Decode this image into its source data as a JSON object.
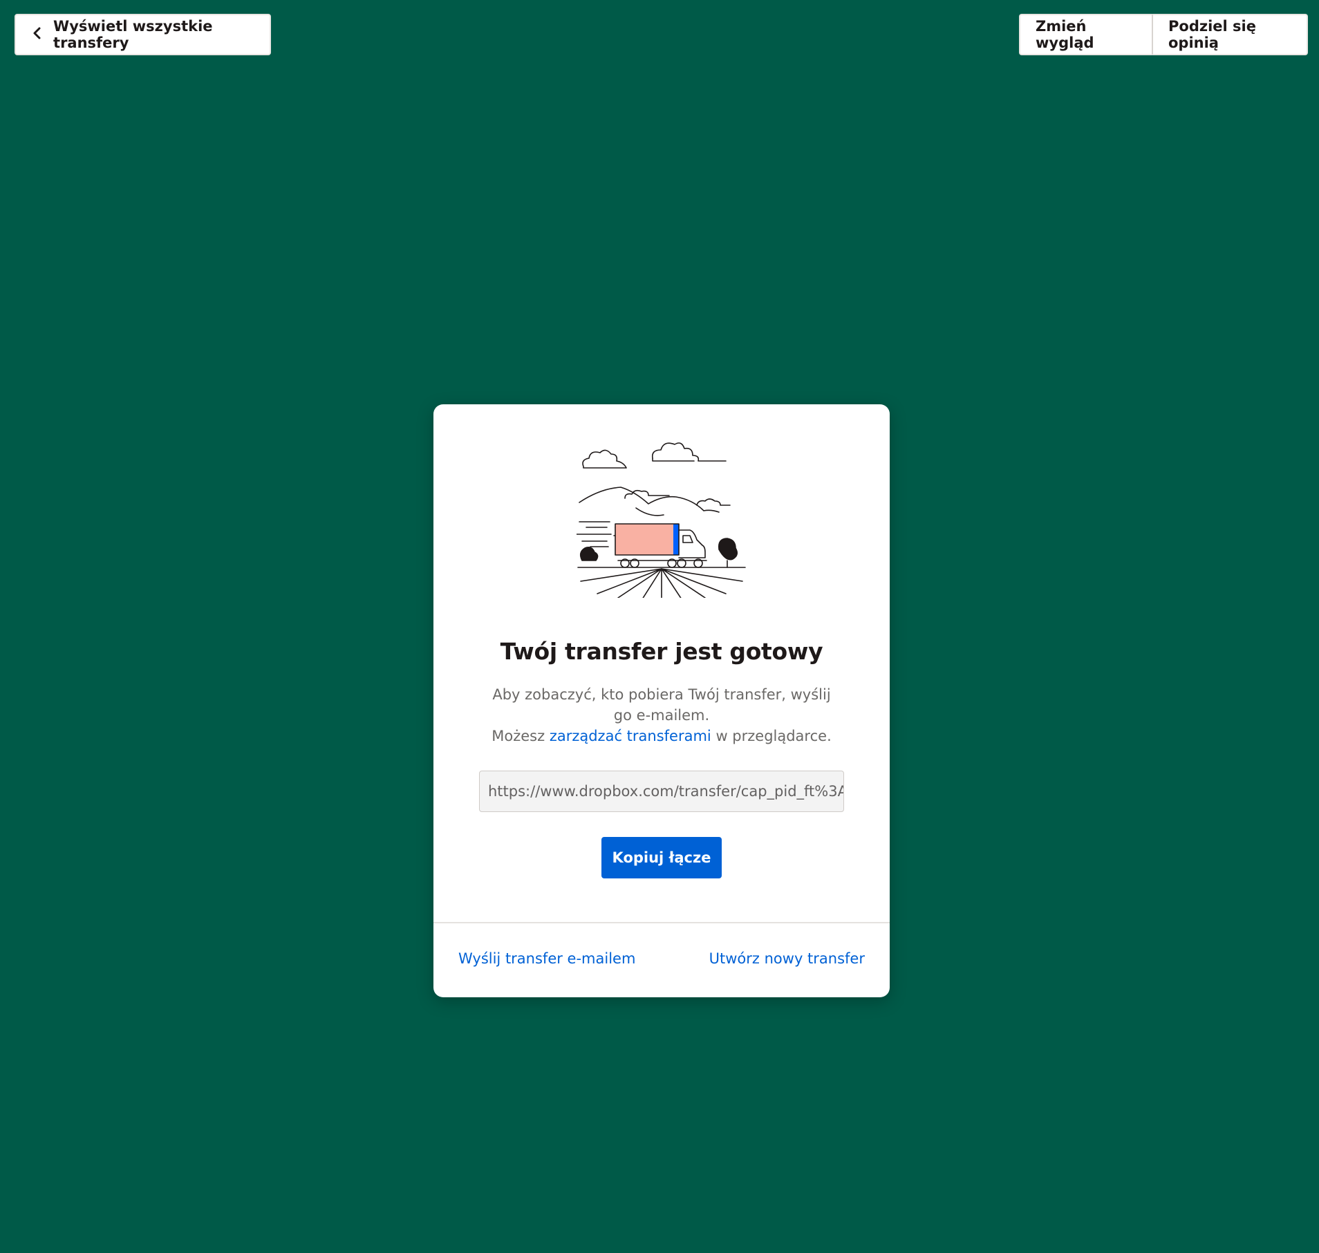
{
  "header": {
    "back_label": "Wyświetl wszystkie transfery",
    "change_view_label": "Zmień wygląd",
    "feedback_label": "Podziel się opinią"
  },
  "card": {
    "title": "Twój transfer jest gotowy",
    "desc_line1": "Aby zobaczyć, kto pobiera Twój transfer, wyślij go e-mailem.",
    "desc_prefix": "Możesz ",
    "desc_link": "zarządzać transferami",
    "desc_suffix": " w przeglądarce.",
    "url_value": "https://www.dropbox.com/transfer/cap_pid_ft%3A",
    "copy_button": "Kopiuj łącze",
    "footer_left": "Wyślij transfer e-mailem",
    "footer_right": "Utwórz nowy transfer"
  },
  "icons": {
    "back": "chevron-left-icon",
    "illustration": "truck-landscape-illustration"
  },
  "colors": {
    "background": "#005a48",
    "accent": "#0061d5",
    "truck_cargo": "#f9b1a3",
    "truck_stripe": "#0061fe"
  }
}
